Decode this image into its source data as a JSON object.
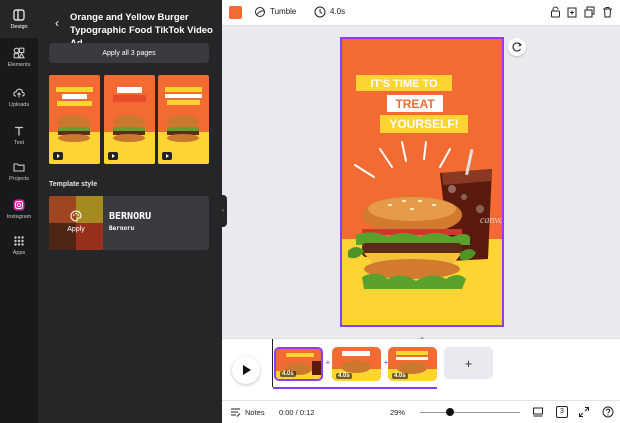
{
  "rail": {
    "items": [
      {
        "label": "Design",
        "icon": "design-icon"
      },
      {
        "label": "Elements",
        "icon": "elements-icon"
      },
      {
        "label": "Uploads",
        "icon": "upload-icon"
      },
      {
        "label": "Text",
        "icon": "text-icon"
      },
      {
        "label": "Projects",
        "icon": "folder-icon"
      },
      {
        "label": "Instagram",
        "icon": "instagram-icon"
      },
      {
        "label": "Apps",
        "icon": "apps-icon"
      }
    ]
  },
  "panel": {
    "title": "Orange and Yellow Burger Typographic Food TikTok Video Ad",
    "apply_all": "Apply all 3 pages",
    "template_style_label": "Template style",
    "style_card": {
      "apply": "Apply",
      "name": "BERNORU",
      "sub": "Bernoru"
    }
  },
  "toolbar": {
    "color": "#f36b33",
    "transition": "Tumble",
    "duration": "4.0s"
  },
  "canvas": {
    "line1": "IT'S TIME TO",
    "line2": "TREAT",
    "line3": "YOURSELF!",
    "cup_text": "canva",
    "colors": {
      "orange": "#f36b33",
      "yellow": "#fdd431",
      "accent": "#8b3dff"
    }
  },
  "timeline": {
    "clips": [
      {
        "duration": "4.0s"
      },
      {
        "duration": "4.0s"
      },
      {
        "duration": "4.0s"
      }
    ],
    "add_label": "+"
  },
  "footer": {
    "notes": "Notes",
    "time": "0:00 / 0:12",
    "zoom": "29%",
    "page_count": "3"
  }
}
